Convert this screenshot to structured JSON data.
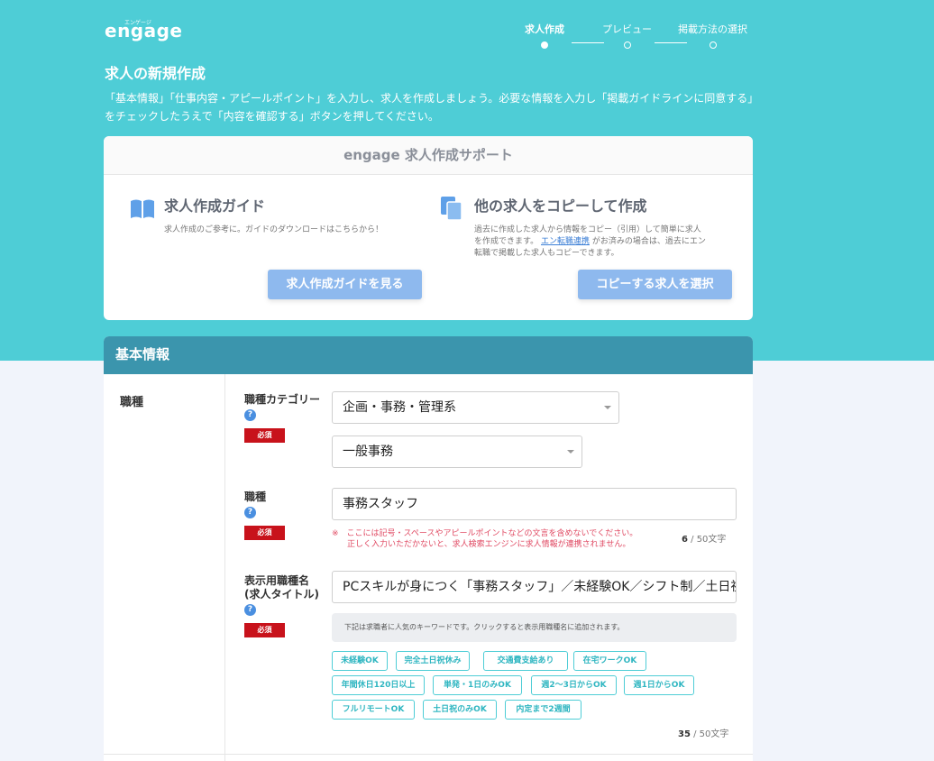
{
  "header": {
    "logo": "engage",
    "logo_ruby": "エンゲージ",
    "steps": [
      {
        "label": "求人作成",
        "active": true
      },
      {
        "label": "プレビュー",
        "active": false
      },
      {
        "label": "掲載方法の選択",
        "active": false
      }
    ]
  },
  "page": {
    "title": "求人の新規作成",
    "intro_line1": "「基本情報」「仕事内容・アピールポイント」を入力し、求人を作成しましょう。必要な情報を入力し「掲載ガイドラインに同意する」",
    "intro_line2": "をチェックしたうえで「内容を確認する」ボタンを押してください。"
  },
  "support": {
    "title": "engage 求人作成サポート",
    "guide": {
      "title": "求人作成ガイド",
      "desc": "求人作成のご参考に。ガイドのダウンロードはこちらから！",
      "button": "求人作成ガイドを見る"
    },
    "copy": {
      "title": "他の求人をコピーして作成",
      "desc_1": "過去に作成した求人から情報をコピー（引用）して簡単に求人",
      "desc_2": "を作成できます。",
      "link": "エン転職連携",
      "desc_3": "がお済みの場合は、過去にエン",
      "desc_4": "転職で掲載した求人もコピーできます。",
      "button": "コピーする求人を選択"
    }
  },
  "basic": {
    "title": "基本情報",
    "section_label": "職種",
    "required": "必須",
    "help": "?",
    "category": {
      "label": "職種カテゴリー",
      "value1": "企画・事務・管理系",
      "value2": "一般事務"
    },
    "job": {
      "label": "職種",
      "value": "事務スタッフ",
      "warn_1": "※　ここには記号・スペースやアピールポイントなどの文言を含めないでください。",
      "warn_2": "正しく入力いただかないと、求人検索エンジンに求人情報が連携されません。",
      "count": "6",
      "max": " / 50文字"
    },
    "display": {
      "label_1": "表示用職種名",
      "label_2": "(求人タイトル)",
      "value": "PCスキルが身につく「事務スタッフ」／未経験OK／シフト制／土日祝",
      "hint": "下記は求職者に人気のキーワードです。クリックすると表示用職種名に追加されます。",
      "keywords": [
        "未経験OK",
        "完全土日祝休み",
        "交通費支給あり",
        "在宅ワークOK",
        "年間休日120日以上",
        "単発・1日のみOK",
        "週2〜3日からOK",
        "週1日からOK",
        "フルリモートOK",
        "土日祝のみOK",
        "内定まで2週間"
      ],
      "count": "35",
      "max": " / 50文字"
    }
  }
}
